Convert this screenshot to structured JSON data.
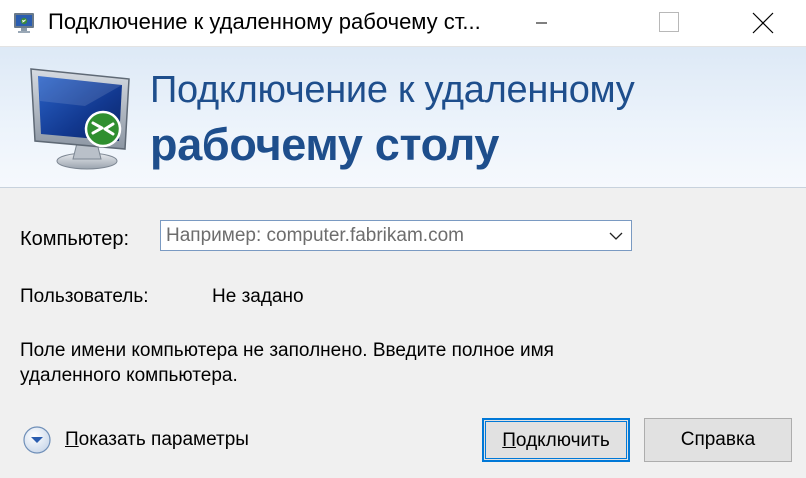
{
  "window": {
    "title": "Подключение к удаленному рабочему ст...",
    "icon": "remote-desktop-icon"
  },
  "banner": {
    "line1": "Подключение к удаленному",
    "line2": "рабочему столу",
    "icon": "monitor-remote-icon"
  },
  "form": {
    "computer_label": "Компьютер:",
    "computer_placeholder": "Например: computer.fabrikam.com",
    "computer_value": "",
    "user_label": "Пользователь:",
    "user_value": "Не задано",
    "warning": "Поле имени компьютера не заполнено. Введите полное имя удаленного компьютера."
  },
  "footer": {
    "options_hotkey": "П",
    "options_rest": "оказать параметры",
    "connect_hotkey": "П",
    "connect_rest": "одключить",
    "help_label": "Справка"
  },
  "colors": {
    "banner_text": "#1e4e8c",
    "focus_border": "#0078d7",
    "button_bg": "#e1e1e1"
  }
}
